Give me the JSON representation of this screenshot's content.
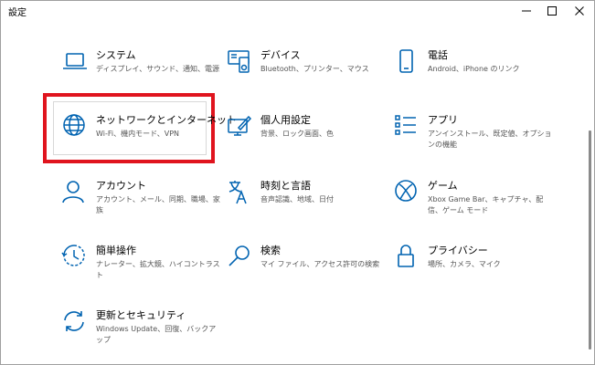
{
  "window": {
    "title": "設定"
  },
  "accent_color": "#0063b1",
  "highlight_color": "#e0141e",
  "tiles": [
    {
      "id": "system",
      "icon": "laptop-icon",
      "label": "システム",
      "desc": "ディスプレイ、サウンド、通知、電源"
    },
    {
      "id": "devices",
      "icon": "devices-icon",
      "label": "デバイス",
      "desc": "Bluetooth、プリンター、マウス"
    },
    {
      "id": "phone",
      "icon": "phone-icon",
      "label": "電話",
      "desc": "Android、iPhone のリンク"
    },
    {
      "id": "network",
      "icon": "globe-icon",
      "label": "ネットワークとインターネット",
      "desc": "Wi-Fi、機内モード、VPN"
    },
    {
      "id": "personalization",
      "icon": "personalization-icon",
      "label": "個人用設定",
      "desc": "背景、ロック画面、色"
    },
    {
      "id": "apps",
      "icon": "apps-list-icon",
      "label": "アプリ",
      "desc": "アンインストール、既定値、オプションの機能"
    },
    {
      "id": "accounts",
      "icon": "person-icon",
      "label": "アカウント",
      "desc": "アカウント、メール、同期、職場、家族"
    },
    {
      "id": "time",
      "icon": "time-language-icon",
      "label": "時刻と言語",
      "desc": "音声認識、地域、日付"
    },
    {
      "id": "gaming",
      "icon": "xbox-icon",
      "label": "ゲーム",
      "desc": "Xbox Game Bar、キャプチャ、配信、ゲーム モード"
    },
    {
      "id": "ease",
      "icon": "ease-of-access-icon",
      "label": "簡単操作",
      "desc": "ナレーター、拡大鏡、ハイコントラスト"
    },
    {
      "id": "search",
      "icon": "search-icon",
      "label": "検索",
      "desc": "マイ ファイル、アクセス許可の検索"
    },
    {
      "id": "privacy",
      "icon": "lock-icon",
      "label": "プライバシー",
      "desc": "場所、カメラ、マイク"
    },
    {
      "id": "update",
      "icon": "sync-icon",
      "label": "更新とセキュリティ",
      "desc": "Windows Update、回復、バックアップ"
    }
  ]
}
